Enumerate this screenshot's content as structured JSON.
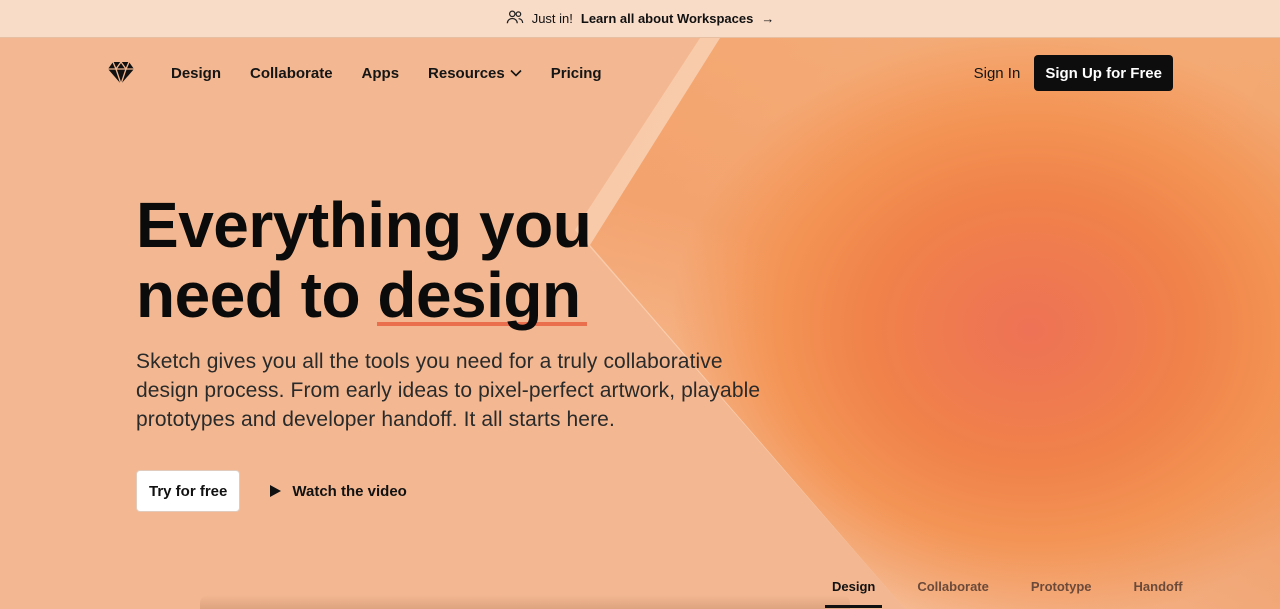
{
  "banner": {
    "prefix": "Just in!",
    "link": "Learn all about Workspaces",
    "icon": "people-icon",
    "arrow": "→"
  },
  "nav": {
    "logo": "sketch-diamond-logo",
    "links": [
      "Design",
      "Collaborate",
      "Apps",
      "Resources",
      "Pricing"
    ],
    "signin": "Sign In",
    "signup": "Sign Up for Free"
  },
  "hero": {
    "line1": "Everything you",
    "line2_start": "need to ",
    "line2_highlight": "design",
    "subtitle": "Sketch gives you all the tools you need for a truly collaborative design process. From early ideas to pixel-perfect artwork, playable prototypes and developer handoff. It all starts here.",
    "try_button": "Try for free",
    "watch_button": "Watch the video"
  },
  "tabs": [
    {
      "label": "Design",
      "active": true
    },
    {
      "label": "Collaborate",
      "active": false
    },
    {
      "label": "Prototype",
      "active": false
    },
    {
      "label": "Handoff",
      "active": false
    }
  ],
  "colors": {
    "background": "#f3b892",
    "accent_underline": "#e96f4d",
    "button_dark": "#0d0d0d",
    "blob": "#ee7256"
  }
}
